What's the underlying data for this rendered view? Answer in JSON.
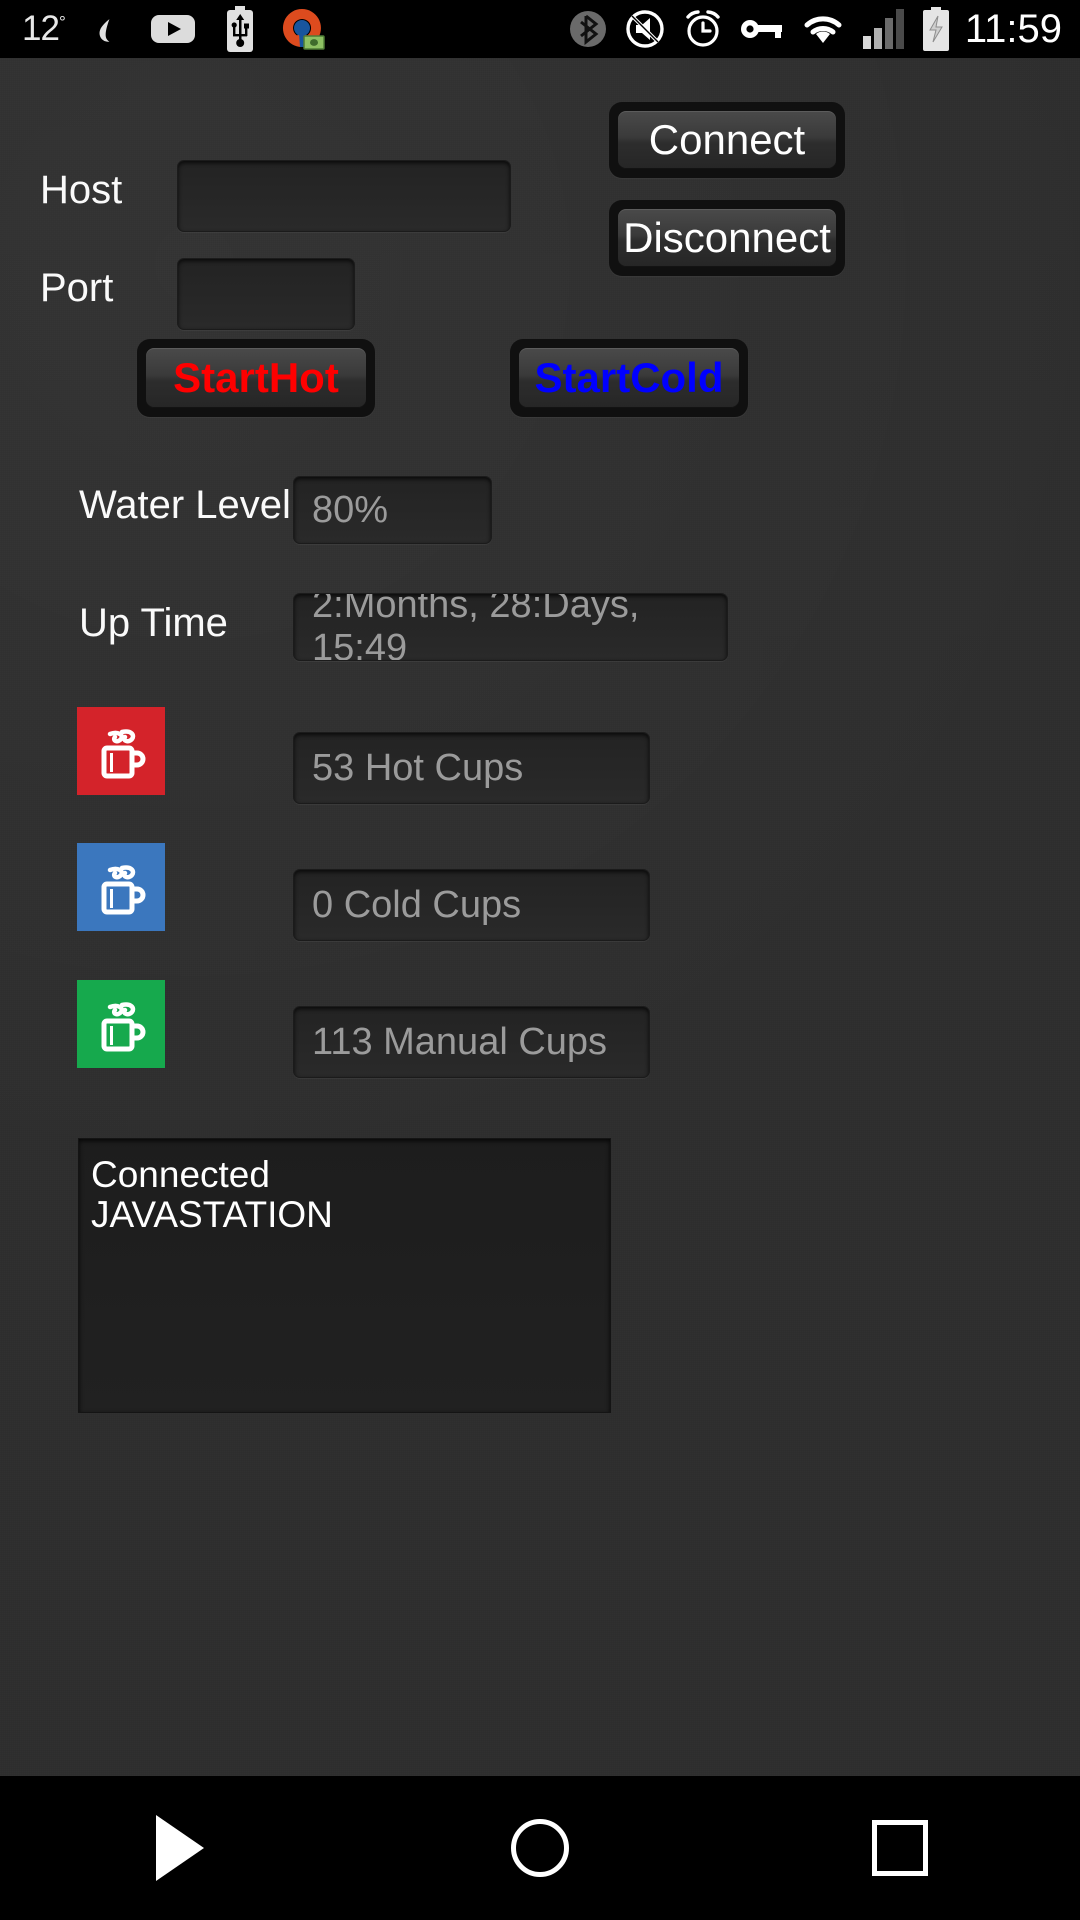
{
  "statusbar": {
    "temperature": "12",
    "degree_symbol": "°",
    "clock": "11:59",
    "icons": [
      {
        "name": "droplet-icon",
        "label": "droplet"
      },
      {
        "name": "youtube-icon",
        "label": "youtube"
      },
      {
        "name": "usb-battery-icon",
        "label": "usb"
      },
      {
        "name": "keyhole-money-icon",
        "label": "keyhole"
      },
      {
        "name": "bluetooth-icon",
        "label": "bluetooth"
      },
      {
        "name": "volume-muted-icon",
        "label": "muted"
      },
      {
        "name": "alarm-clock-icon",
        "label": "alarm"
      },
      {
        "name": "vpn-key-icon",
        "label": "vpn"
      },
      {
        "name": "wifi-icon",
        "label": "wifi"
      },
      {
        "name": "cellular-signal-icon",
        "label": "signal"
      },
      {
        "name": "battery-charging-icon",
        "label": "charging"
      }
    ]
  },
  "form": {
    "host_label": "Host",
    "host_value": "",
    "host_placeholder": "",
    "port_label": "Port",
    "port_value": "",
    "port_placeholder": ""
  },
  "actions": {
    "connect_label": "Connect",
    "disconnect_label": "Disconnect",
    "start_hot_label": "StartHot",
    "start_cold_label": "StartCold"
  },
  "status": {
    "water_level_label": "Water Level",
    "water_level_value": "80%",
    "uptime_label": "Up Time",
    "uptime_value": "2:Months, 28:Days, 15:49"
  },
  "counters": [
    {
      "icon": "hot-cup-icon",
      "value": "53 Hot Cups"
    },
    {
      "icon": "cold-cup-icon",
      "value": "0 Cold Cups"
    },
    {
      "icon": "manual-cup-icon",
      "value": "113 Manual Cups"
    }
  ],
  "log": {
    "line1": "Connected",
    "line2": "JAVASTATION"
  },
  "navbar": {
    "back_label": "Back",
    "home_label": "Home",
    "recents_label": "Recents"
  },
  "colors": {
    "hot": "#d4232a",
    "cold": "#3b77be",
    "manual": "#16a94d",
    "start_hot_text": "#ff0000",
    "start_cold_text": "#0000ff",
    "background": "#2e2e2e"
  }
}
